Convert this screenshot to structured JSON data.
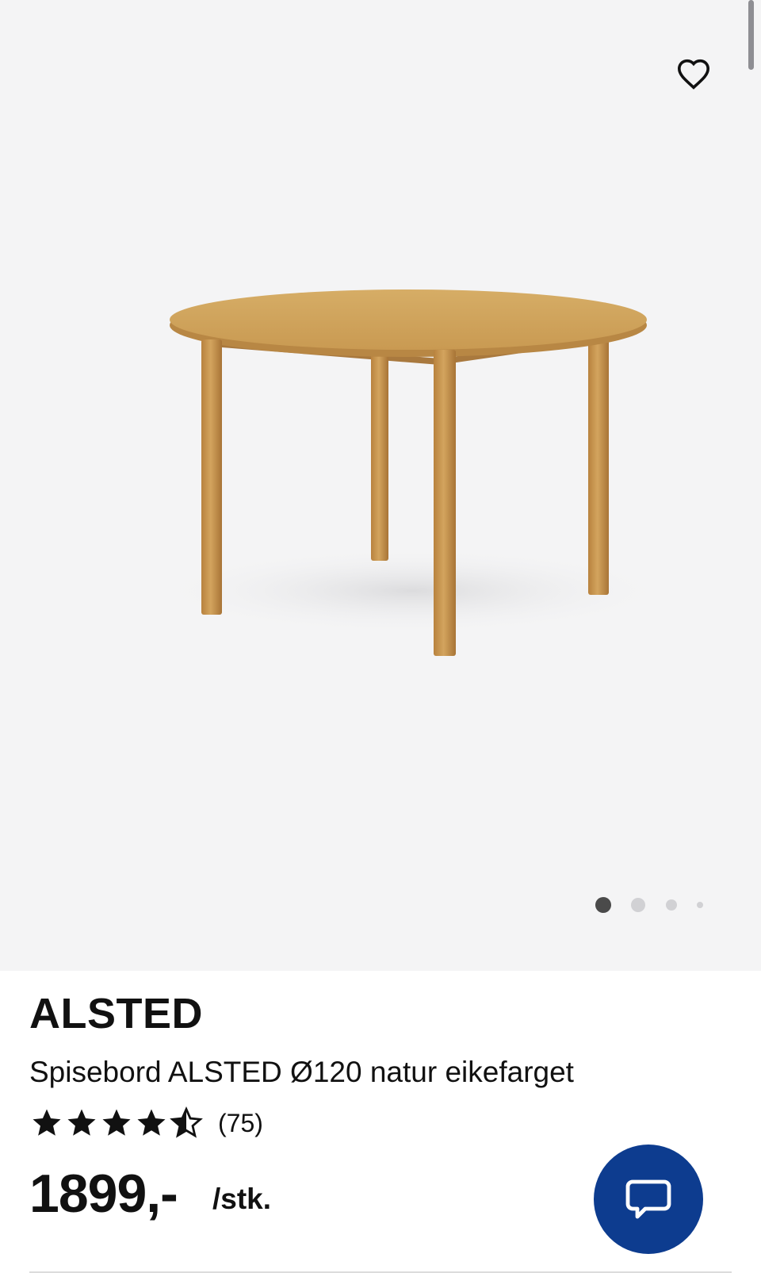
{
  "product": {
    "brand": "ALSTED",
    "description": "Spisebord ALSTED Ø120 natur eikefarget",
    "rating_value": 4.5,
    "rating_max": 5,
    "rating_count": "(75)",
    "price": "1899,-",
    "unit": "/stk."
  },
  "gallery": {
    "image_count": 4,
    "active_index": 0
  },
  "icons": {
    "favorite": "heart-outline-icon",
    "chat": "chat-bubble-icon",
    "star": "star-icon"
  },
  "colors": {
    "gallery_bg": "#f4f4f5",
    "chat_button": "#0d3c8f",
    "wood": "#c89a52"
  }
}
